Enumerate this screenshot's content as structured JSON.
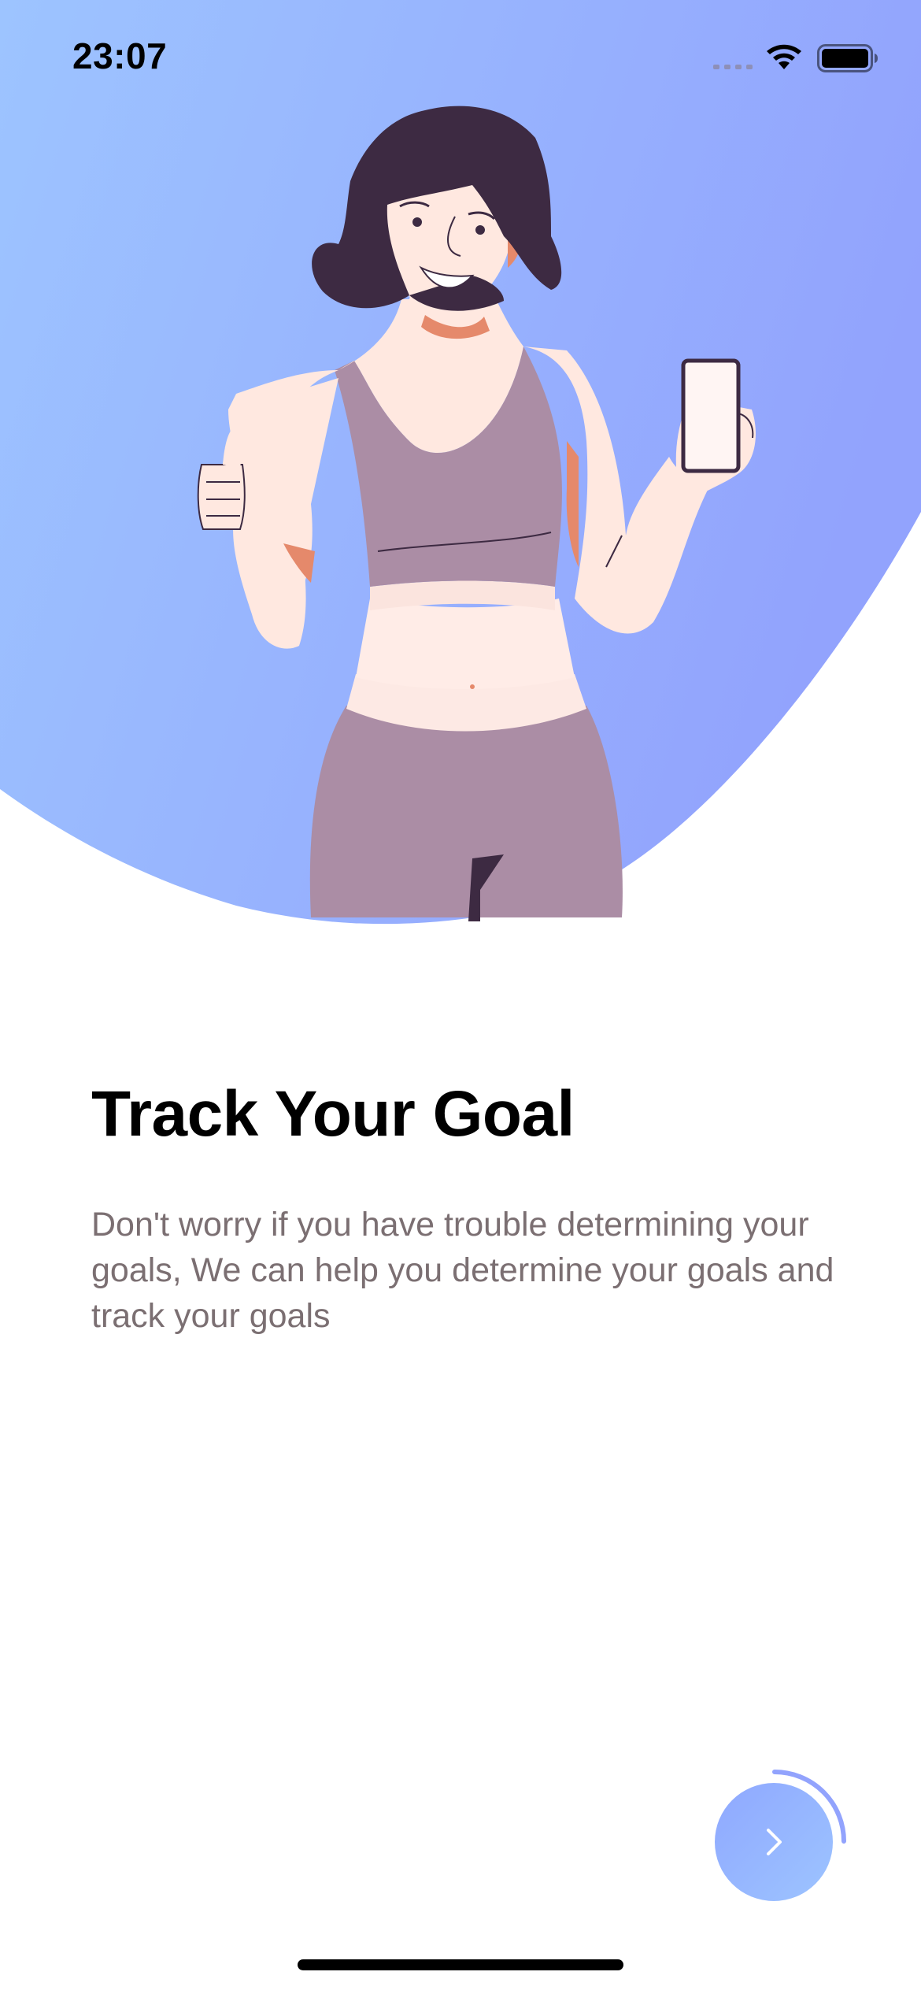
{
  "status_bar": {
    "time": "23:07",
    "icons": [
      "signal-icon",
      "wifi-icon",
      "battery-icon"
    ]
  },
  "hero": {
    "illustration": "woman-thumbs-up-holding-phone-illustration",
    "gradient_start": "#9DC4FF",
    "gradient_end": "#92A3FD"
  },
  "onboarding": {
    "title": "Track Your Goal",
    "description": "Don't worry if you have trouble determining your goals, We can help you determine your goals and track your goals"
  },
  "next_button": {
    "icon": "chevron-right-icon",
    "progress": 0.25,
    "accent": "#92A3FD"
  }
}
